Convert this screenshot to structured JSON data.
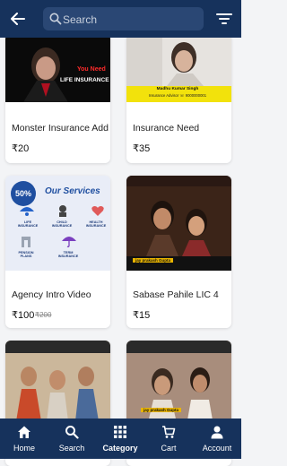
{
  "search": {
    "placeholder": "Search"
  },
  "products": [
    {
      "title": "Monster Insurance Add",
      "price": "₹20",
      "mrp": "",
      "thumb_caption_line1": "You Need",
      "thumb_caption_line2": "LIFE INSURANCE"
    },
    {
      "title": "Insurance Need",
      "price": "₹35",
      "mrp": "",
      "thumb_caption_line1": "Madhu Kumar Singh",
      "thumb_caption_line2": "Insurance Advisor  ☏ 9000000001"
    },
    {
      "title": "Agency Intro Video",
      "price": "₹100",
      "mrp": "₹200",
      "badge": "50%",
      "services_heading": "Our Services",
      "services": [
        "LIFE INSURANCE",
        "CHILD INSURANCE",
        "HEALTH INSURANCE",
        "PENSION PLANS",
        "TERM INSURANCE"
      ]
    },
    {
      "title": "Sabase Pahile LIC 4",
      "price": "₹15",
      "mrp": "",
      "thumb_caption_line1": "jay prakash Gupta"
    },
    {
      "title": "",
      "price": "",
      "mrp": ""
    },
    {
      "title": "",
      "price": "",
      "mrp": "",
      "thumb_caption_line1": "jay prakash Gupta"
    }
  ],
  "nav": {
    "items": [
      {
        "label": "Home",
        "icon": "home-icon"
      },
      {
        "label": "Search",
        "icon": "search-icon"
      },
      {
        "label": "Category",
        "icon": "grid-icon",
        "active": true
      },
      {
        "label": "Cart",
        "icon": "cart-icon"
      },
      {
        "label": "Account",
        "icon": "account-icon"
      }
    ]
  },
  "colors": {
    "primary": "#16325c",
    "badge": "#1f4fa0"
  }
}
